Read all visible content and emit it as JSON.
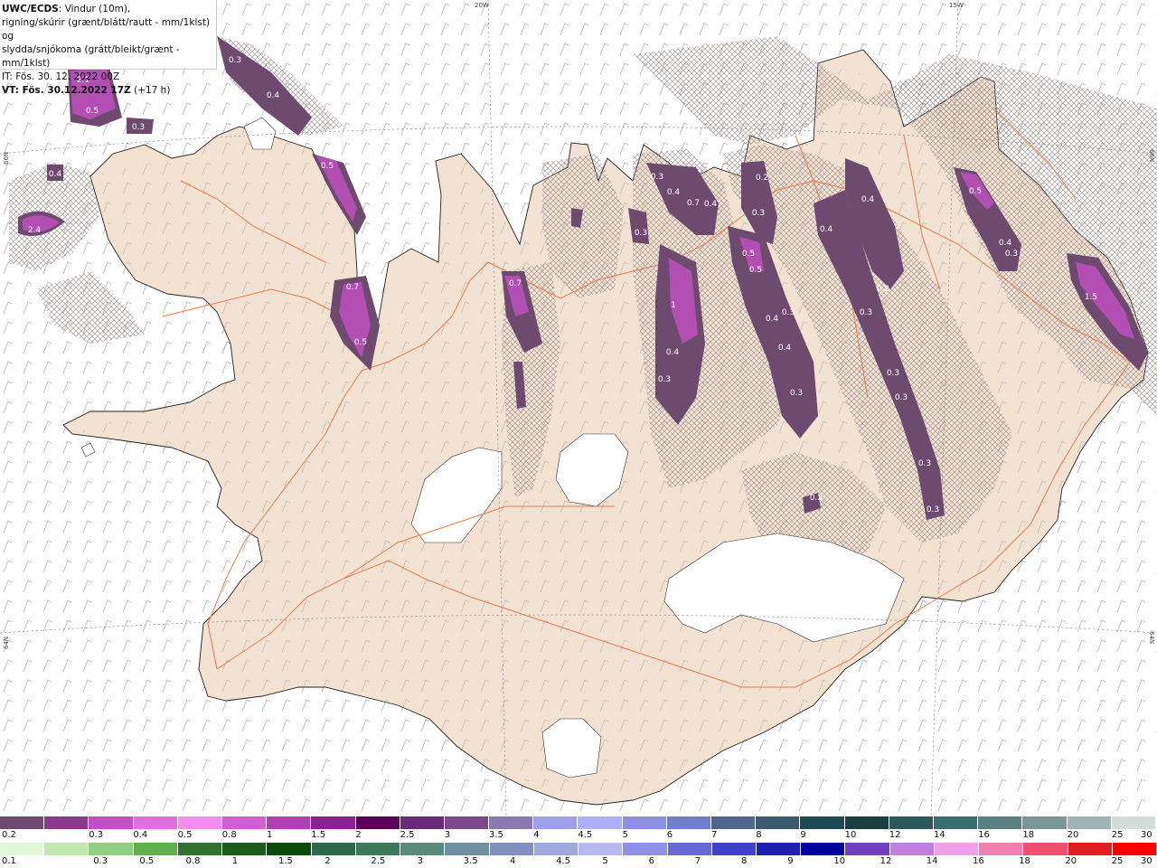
{
  "title": {
    "model": "UWC/ECDS",
    "line1_rest": ": Vindur (10m),",
    "line2": "rigning/skúrir (grænt/blátt/rautt - mm/1klst) og",
    "line3": "slydda/snjókoma (grátt/bleikt/grænt - mm/1klst)",
    "line4": "IT: Fös. 30. 12. 2022 00Z",
    "line5_bold": "VT: Fös. 30.12.2022 17Z",
    "line5_rest": " (+17 h)"
  },
  "graticule": {
    "top_labels": [
      "20W",
      "15W"
    ],
    "left_labels": [
      "66N",
      "64N"
    ],
    "right_labels": [
      "66N",
      "64N"
    ]
  },
  "map_style": {
    "sea_color": "#ffffff",
    "land_color": "#f2e2d2",
    "coast_color": "#222222",
    "road_color": "#f07a4a",
    "glacier_color": "#ffffff"
  },
  "precip_labels": [
    {
      "value": "2.1"
    },
    {
      "value": "0.5"
    },
    {
      "value": "0.3"
    },
    {
      "value": "0.4"
    },
    {
      "value": "2.4"
    },
    {
      "value": "0.3"
    },
    {
      "value": "0.4"
    },
    {
      "value": "0.5"
    },
    {
      "value": "0.7"
    },
    {
      "value": "0.5"
    },
    {
      "value": "0.7"
    },
    {
      "value": "0.3"
    },
    {
      "value": "0.4"
    },
    {
      "value": "0.7"
    },
    {
      "value": "0.4"
    },
    {
      "value": "0.2"
    },
    {
      "value": "0.3"
    },
    {
      "value": "0.3"
    },
    {
      "value": "1"
    },
    {
      "value": "0.4"
    },
    {
      "value": "0.3"
    },
    {
      "value": "0.5"
    },
    {
      "value": "0.5"
    },
    {
      "value": "0.4"
    },
    {
      "value": "0.3"
    },
    {
      "value": "0.4"
    },
    {
      "value": "0.3"
    },
    {
      "value": "0.4"
    },
    {
      "value": "0.4"
    },
    {
      "value": "0.2"
    },
    {
      "value": "0.3"
    },
    {
      "value": "0.3"
    },
    {
      "value": "0.3"
    },
    {
      "value": "0.3"
    },
    {
      "value": "0.3"
    },
    {
      "value": "0.2"
    },
    {
      "value": "0.5"
    },
    {
      "value": "0.4"
    },
    {
      "value": "0.3"
    },
    {
      "value": "1.5"
    }
  ],
  "legend": {
    "snow": {
      "labels": [
        "0.2",
        "0.3",
        "0.4",
        "0.5",
        "0.8",
        "1",
        "1.5",
        "2",
        "2.5",
        "3",
        "3.5",
        "4",
        "4.5",
        "5",
        "6",
        "7",
        "8",
        "9",
        "10",
        "12",
        "14",
        "16",
        "18",
        "20",
        "25",
        "30"
      ],
      "colors": [
        "#6e4a6e",
        "#8a3a8a",
        "#c050c0",
        "#e070e0",
        "#f090f0",
        "#d060d0",
        "#b040b0",
        "#8c208c",
        "#5a005a",
        "#6a2a7a",
        "#7a4a8a",
        "#8a7ab0",
        "#a0a0e8",
        "#b0b0f8",
        "#9090e0",
        "#7080c8",
        "#506890",
        "#3a5a70",
        "#1e4a52",
        "#1a4040",
        "#2a5a5a",
        "#3a6e6e",
        "#5a8080",
        "#7a9696",
        "#a0b4b4",
        "#d4dcdc"
      ]
    },
    "rain": {
      "labels": [
        "0.1",
        "0.3",
        "0.5",
        "0.8",
        "1",
        "1.5",
        "2",
        "2.5",
        "3",
        "3.5",
        "4",
        "4.5",
        "5",
        "6",
        "7",
        "8",
        "9",
        "10",
        "12",
        "14",
        "16",
        "18",
        "20",
        "25",
        "30"
      ],
      "colors": [
        "#e0f8d8",
        "#c0e8b0",
        "#90d080",
        "#60b050",
        "#307030",
        "#1a5a1a",
        "#0a4a0a",
        "#2a6a4a",
        "#3a7a5a",
        "#5a8a7a",
        "#7090a0",
        "#8090c0",
        "#a0a8e0",
        "#b8b8f0",
        "#9090e8",
        "#6868d8",
        "#4040c8",
        "#2020b0",
        "#0000a0",
        "#7040c0",
        "#c080e0",
        "#f0a0e8",
        "#f080b0",
        "#f05070",
        "#e02020",
        "#ff0000"
      ]
    }
  }
}
